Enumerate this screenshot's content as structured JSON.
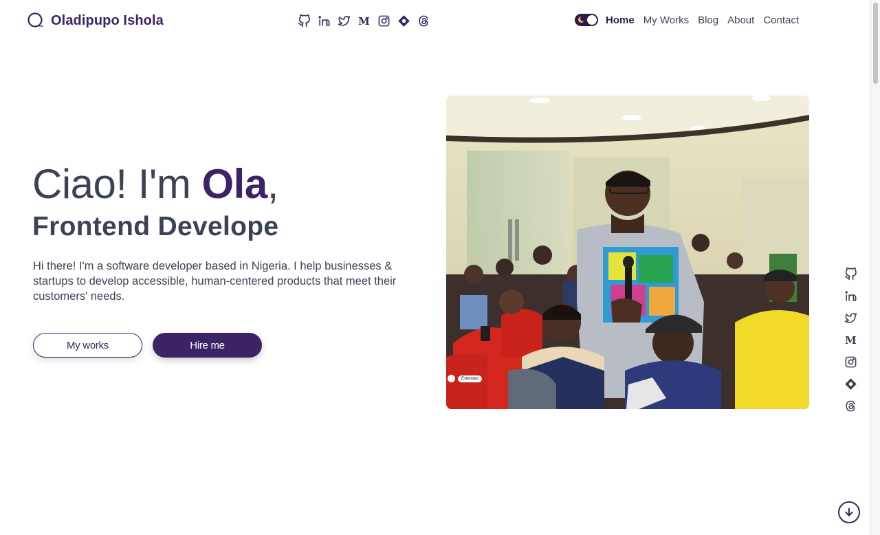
{
  "brand": {
    "name": "Oladipupo Ishola",
    "logo_icon": "circle-logo-icon"
  },
  "social": [
    {
      "name": "github-icon"
    },
    {
      "name": "linkedin-icon"
    },
    {
      "name": "twitter-icon"
    },
    {
      "name": "medium-icon"
    },
    {
      "name": "instagram-icon"
    },
    {
      "name": "hashnode-icon"
    },
    {
      "name": "threads-icon"
    }
  ],
  "nav": {
    "theme_toggle": "dark-mode-toggle",
    "items": [
      {
        "label": "Home",
        "active": true
      },
      {
        "label": "My Works"
      },
      {
        "label": "Blog"
      },
      {
        "label": "About"
      },
      {
        "label": "Contact"
      }
    ]
  },
  "hero": {
    "greeting": "Ciao! I'm ",
    "name": "Ola",
    "comma": ",",
    "role": "Frontend Develope",
    "description": "Hi there! I'm a software developer based in Nigeria. I help businesses & startups to develop accessible, human-centered products that meet their customers' needs.",
    "primary_button": "Hire me",
    "secondary_button": "My works"
  },
  "photo": {
    "chip_label": "Extended"
  },
  "colors": {
    "brand": "#3b2466",
    "text": "#3a4256",
    "background": "#ffffff"
  }
}
